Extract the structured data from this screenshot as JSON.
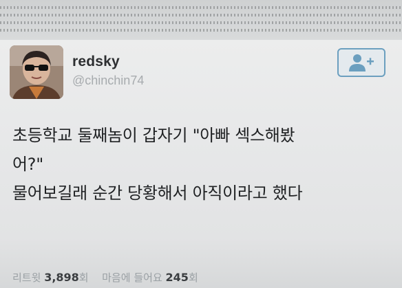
{
  "profile": {
    "display_name": "redsky",
    "handle": "@chinchin74"
  },
  "follow_button": {
    "icon": "add-user-icon",
    "color": "#6b9fbf"
  },
  "tweet": {
    "lines": [
      "초등학교 둘째놈이 갑자기  \"아빠  섹스해봤",
      "어?\"",
      "물어보길래 순간 당황해서  아직이라고 했다"
    ]
  },
  "stats": {
    "retweets_label": "리트윗",
    "retweets_count": "3,898",
    "retweets_unit": "회",
    "likes_label": "마음에 들어요",
    "likes_count": "245",
    "likes_unit": "회"
  }
}
